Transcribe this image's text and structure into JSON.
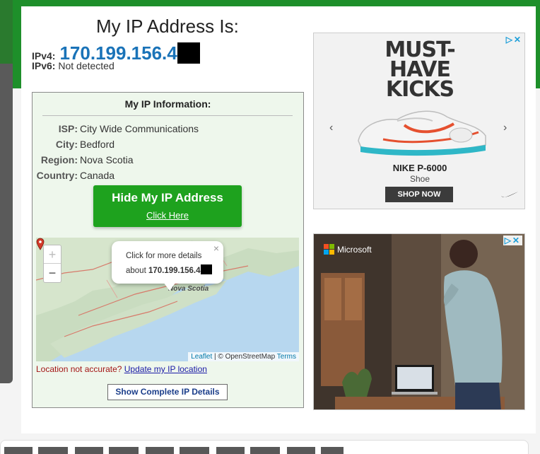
{
  "header": {
    "title": "My IP Address Is:",
    "ipv4_label": "IPv4:",
    "ipv4_value": "170.199.156.4",
    "ipv6_label": "IPv6:",
    "ipv6_value": "Not detected"
  },
  "info": {
    "title": "My IP Information:",
    "rows": [
      {
        "key": "ISP:",
        "value": "City Wide Communications"
      },
      {
        "key": "City:",
        "value": "Bedford"
      },
      {
        "key": "Region:",
        "value": "Nova Scotia"
      },
      {
        "key": "Country:",
        "value": "Canada"
      }
    ],
    "hide_button": {
      "title": "Hide My IP Address",
      "subtitle": "Click Here"
    },
    "map": {
      "zoom_in": "+",
      "zoom_out": "−",
      "popup_line1": "Click for more details",
      "popup_line2_prefix": "about ",
      "popup_ip": "170.199.156.4",
      "popup_close": "×",
      "place_label": "Nova Scotia",
      "attrib_leaflet": "Leaflet",
      "attrib_sep": " | © OpenStreetMap ",
      "attrib_terms": "Terms"
    },
    "location_question": "Location not accurate?",
    "location_link": "Update my IP location",
    "details_button": "Show Complete IP Details"
  },
  "ad_top": {
    "adchoices": "▷✕",
    "headline_lines": [
      "MUST-",
      "HAVE",
      "KICKS"
    ],
    "product_name": "NIKE P-6000",
    "product_type": "Shoe",
    "cta": "SHOP NOW",
    "prev": "‹",
    "next": "›"
  },
  "ad_bottom": {
    "adchoices": "▷✕",
    "brand": "Microsoft",
    "colors": [
      "#f25022",
      "#7fba00",
      "#00a4ef",
      "#ffb900"
    ]
  }
}
